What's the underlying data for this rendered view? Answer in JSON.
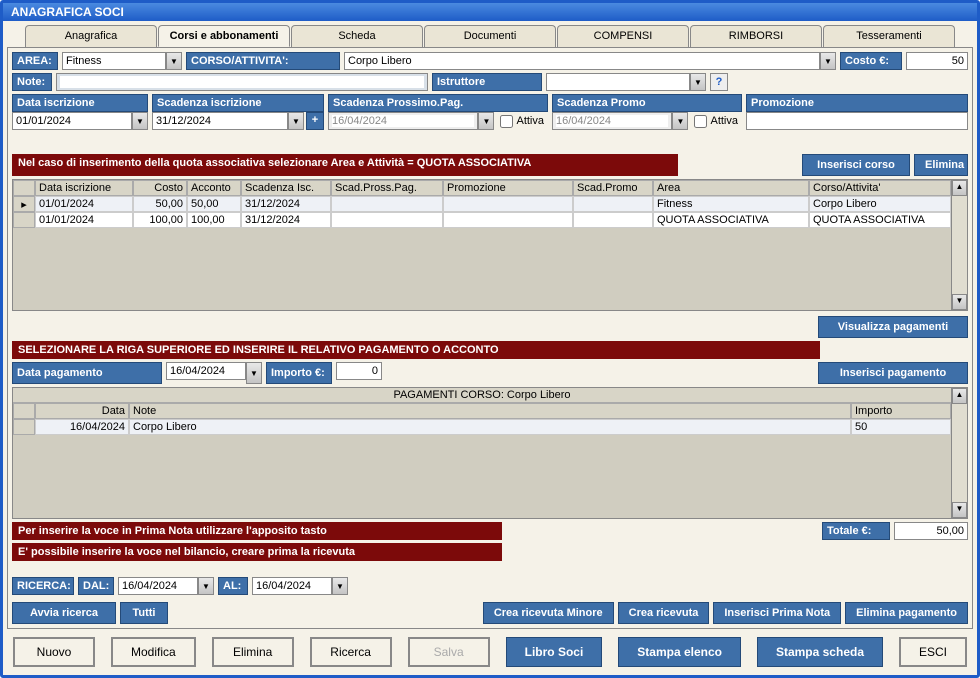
{
  "window_title": "ANAGRAFICA SOCI",
  "tabs": [
    "Anagrafica",
    "Corsi e abbonamenti",
    "Scheda",
    "Documenti",
    "COMPENSI",
    "RIMBORSI",
    "Tesseramenti"
  ],
  "top": {
    "area_label": "AREA:",
    "area_value": "Fitness",
    "corso_label": "CORSO/ATTIVITA':",
    "corso_value": "Corpo Libero",
    "costo_label": "Costo €:",
    "costo_value": "50",
    "note_label": "Note:",
    "note_value": "",
    "istruttore_label": "Istruttore",
    "istruttore_value": "",
    "data_iscr_label": "Data iscrizione",
    "data_iscr_value": "01/01/2024",
    "scad_iscr_label": "Scadenza iscrizione",
    "scad_iscr_value": "31/12/2024",
    "scad_pross_label": "Scadenza Prossimo.Pag.",
    "scad_pross_value": "16/04/2024",
    "attiva1": "Attiva",
    "scad_promo_label": "Scadenza Promo",
    "scad_promo_value": "16/04/2024",
    "attiva2": "Attiva",
    "promozione_label": "Promozione",
    "promozione_value": ""
  },
  "banner1": "Nel caso di inserimento della quota associativa selezionare Area e Attività = QUOTA ASSOCIATIVA",
  "btn_inserisci_corso": "Inserisci corso",
  "btn_elimina_top": "Elimina",
  "grid1": {
    "headers": [
      "Data iscrizione",
      "Costo",
      "Acconto",
      "Scadenza Isc.",
      "Scad.Pross.Pag.",
      "Promozione",
      "Scad.Promo",
      "Area",
      "Corso/Attivita'"
    ],
    "rows": [
      {
        "data": "01/01/2024",
        "costo": "50,00",
        "acconto": "50,00",
        "scad": "31/12/2024",
        "spp": "",
        "promo": "",
        "sp": "",
        "area": "Fitness",
        "corso": "Corpo Libero"
      },
      {
        "data": "01/01/2024",
        "costo": "100,00",
        "acconto": "100,00",
        "scad": "31/12/2024",
        "spp": "",
        "promo": "",
        "sp": "",
        "area": "QUOTA ASSOCIATIVA",
        "corso": "QUOTA ASSOCIATIVA"
      }
    ]
  },
  "btn_visualizza_pag": "Visualizza pagamenti",
  "banner2": "SELEZIONARE LA RIGA SUPERIORE ED INSERIRE IL RELATIVO PAGAMENTO O ACCONTO",
  "pag": {
    "data_label": "Data pagamento",
    "data_value": "16/04/2024",
    "importo_label": "Importo €:",
    "importo_value": "0"
  },
  "btn_inserisci_pag": "Inserisci pagamento",
  "grid2_title": "PAGAMENTI CORSO: Corpo Libero",
  "grid2": {
    "headers": [
      "Data",
      "Note",
      "Importo"
    ],
    "rows": [
      {
        "data": "16/04/2024",
        "note": "Corpo Libero",
        "importo": "50"
      }
    ]
  },
  "banner3": "Per inserire la voce in Prima Nota utilizzare l'apposito tasto",
  "banner4": "E' possibile inserire la voce nel bilancio, creare prima la ricevuta",
  "totale_label": "Totale €:",
  "totale_value": "50,00",
  "ricerca": {
    "label": "RICERCA:",
    "dal": "DAL:",
    "dal_value": "16/04/2024",
    "al": "AL:",
    "al_value": "16/04/2024"
  },
  "btn_avvia_ricerca": "Avvia ricerca",
  "btn_tutti": "Tutti",
  "btn_crea_ricevuta_minore": "Crea ricevuta Minore",
  "btn_crea_ricevuta": "Crea ricevuta",
  "btn_inserisci_prima_nota": "Inserisci Prima Nota",
  "btn_elimina_pagamento": "Elimina pagamento",
  "bottom": {
    "nuovo": "Nuovo",
    "modifica": "Modifica",
    "elimina": "Elimina",
    "ricerca": "Ricerca",
    "salva": "Salva",
    "libro": "Libro Soci",
    "stampa_elenco": "Stampa elenco",
    "stampa_scheda": "Stampa scheda",
    "esci": "ESCI"
  }
}
